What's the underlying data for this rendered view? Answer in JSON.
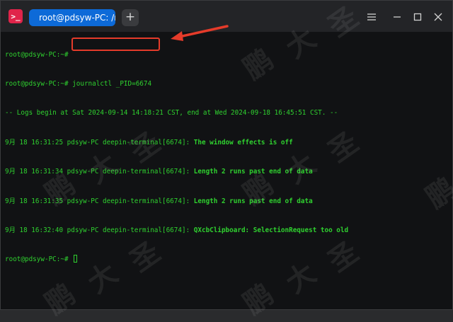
{
  "titlebar": {
    "app_icon": "terminal-icon",
    "tab_title": "root@pdsyw-PC: /root",
    "new_tab_label": "+",
    "controls": [
      "menu-icon",
      "minimize-icon",
      "maximize-icon",
      "close-icon"
    ]
  },
  "terminal": {
    "lines": [
      {
        "prompt": "root@pdsyw-PC:~# ",
        "text": ""
      },
      {
        "prompt": "root@pdsyw-PC:~# ",
        "text": "journalctl _PID=6674"
      },
      {
        "prompt": "",
        "text": "-- Logs begin at Sat 2024-09-14 14:18:21 CST, end at Wed 2024-09-18 16:45:51 CST. --"
      },
      {
        "prefix": "9月 18 16:31:25 pdsyw-PC deepin-terminal[6674]: ",
        "message": "The window effects is off"
      },
      {
        "prefix": "9月 18 16:31:34 pdsyw-PC deepin-terminal[6674]: ",
        "message": "Length 2 runs past end of data"
      },
      {
        "prefix": "9月 18 16:31:35 pdsyw-PC deepin-terminal[6674]: ",
        "message": "Length 2 runs past end of data"
      },
      {
        "prefix": "9月 18 16:32:40 pdsyw-PC deepin-terminal[6674]: ",
        "message": "QXcbClipboard: SelectionRequest too old"
      },
      {
        "prompt": "root@pdsyw-PC:~# ",
        "text": ""
      }
    ]
  },
  "annotation": {
    "box_color": "#e53b2a",
    "arrow_color": "#e53b2a"
  },
  "watermark": {
    "chars": [
      "鹏",
      "大",
      "圣"
    ]
  },
  "colors": {
    "terminal_text": "#2fd12f",
    "tab_active": "#0d6ad8",
    "titlebar": "#232427",
    "background": "#111214"
  }
}
